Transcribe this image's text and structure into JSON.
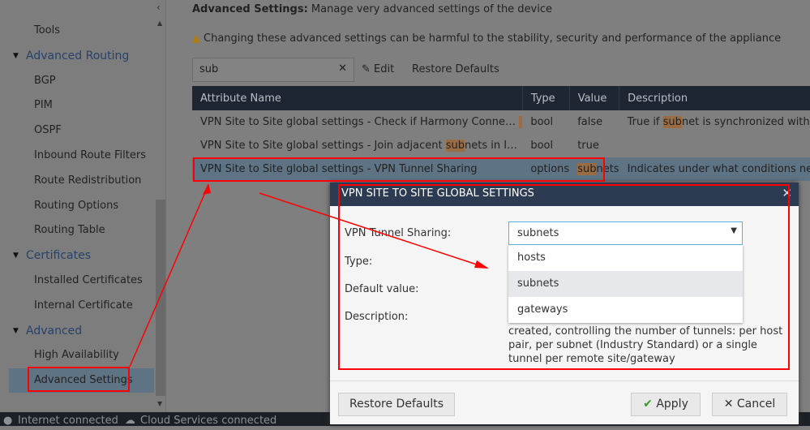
{
  "sidebar": {
    "items": [
      {
        "label": "Tools",
        "kind": "sub"
      },
      {
        "label": "Advanced Routing",
        "kind": "grp"
      },
      {
        "label": "BGP",
        "kind": "sub"
      },
      {
        "label": "PIM",
        "kind": "sub"
      },
      {
        "label": "OSPF",
        "kind": "sub"
      },
      {
        "label": "Inbound Route Filters",
        "kind": "sub"
      },
      {
        "label": "Route Redistribution",
        "kind": "sub"
      },
      {
        "label": "Routing Options",
        "kind": "sub"
      },
      {
        "label": "Routing Table",
        "kind": "sub"
      },
      {
        "label": "Certificates",
        "kind": "grp"
      },
      {
        "label": "Installed Certificates",
        "kind": "sub"
      },
      {
        "label": "Internal Certificate",
        "kind": "sub"
      },
      {
        "label": "Advanced",
        "kind": "grp"
      },
      {
        "label": "High Availability",
        "kind": "sub"
      },
      {
        "label": "Advanced Settings",
        "kind": "sub",
        "selected": true
      }
    ]
  },
  "header": {
    "title_bold": "Advanced Settings:",
    "title_rest": " Manage very advanced settings of the device",
    "warning": "Changing these advanced settings can be harmful to the stability, security and performance of the appliance"
  },
  "toolbar": {
    "search_value": "sub",
    "edit": "Edit",
    "restore": "Restore Defaults"
  },
  "table": {
    "columns": [
      "Attribute Name",
      "Type",
      "Value",
      "Description"
    ],
    "rows": [
      {
        "name": "VPN Site to Site global settings - Check if Harmony Conne…",
        "type": "bool",
        "value": "false",
        "desc_pre": "True if ",
        "desc_hl": "sub",
        "desc_post": "net is synchronized with I"
      },
      {
        "name_pre": "VPN Site to Site global settings - Join adjacent ",
        "name_hl": "sub",
        "name_post": "nets in I…",
        "type": "bool",
        "value": "true"
      },
      {
        "name": "VPN Site to Site global settings - VPN Tunnel Sharing",
        "type": "options",
        "value_hl": "sub",
        "value_post": "nets",
        "desc": "Indicates under what conditions new"
      }
    ]
  },
  "modal": {
    "title": "VPN SITE TO SITE GLOBAL SETTINGS",
    "labels": {
      "sharing": "VPN Tunnel Sharing:",
      "type": "Type:",
      "default": "Default value:",
      "description": "Description:"
    },
    "selected": "subnets",
    "options": [
      "hosts",
      "subnets",
      "gateways"
    ],
    "description": "created, controlling the number of tunnels: per host pair, per subnet (Industry Standard) or a single tunnel per remote site/gateway",
    "restore": "Restore Defaults",
    "apply": "Apply",
    "cancel": "Cancel"
  },
  "status": {
    "internet": "Internet connected",
    "cloud": "Cloud Services connected"
  },
  "colors": {
    "annotation": "#ff0000",
    "header": "#1f2633",
    "modal_header": "#2d3b52",
    "highlight": "#9a6c44"
  }
}
